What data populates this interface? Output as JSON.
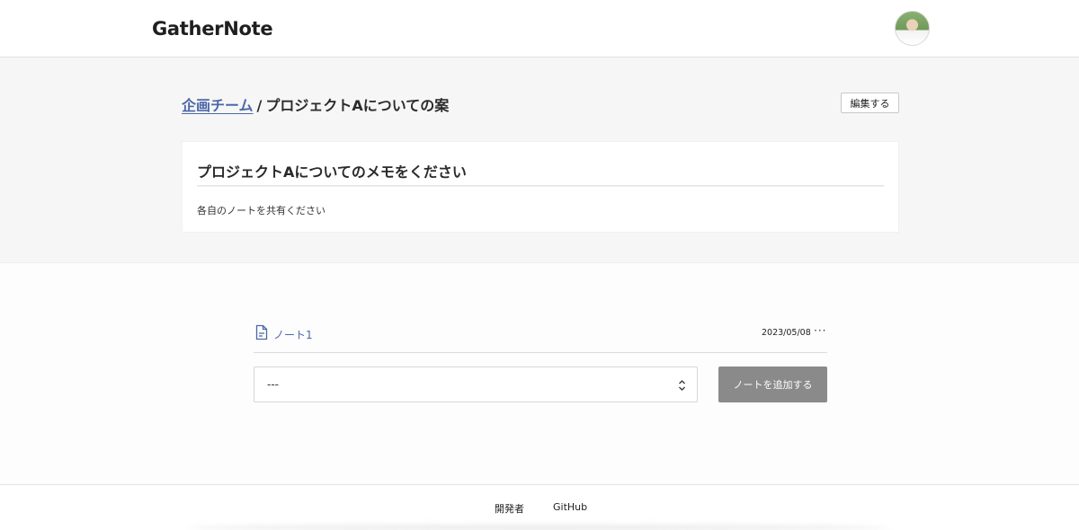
{
  "header": {
    "logo": "GatherNote",
    "avatar_icon": "user-avatar"
  },
  "breadcrumb": {
    "team": "企画チーム",
    "separator": "/",
    "current": "プロジェクトAについての案"
  },
  "edit_button": "編集する",
  "card": {
    "title": "プロジェクトAについてのメモをください",
    "body": "各自のノートを共有ください"
  },
  "notes": [
    {
      "icon": "document-icon",
      "name": "ノート1",
      "date": "2023/05/08",
      "menu": "···"
    }
  ],
  "note_select": {
    "value": "---",
    "arrow_icon": "select-updown-icon"
  },
  "add_note_button": "ノートを追加する",
  "footer": {
    "links": [
      "開発者",
      "GitHub"
    ]
  },
  "colors": {
    "accent": "#4b68a8",
    "band": "#f6f6f6",
    "button_gray": "#8a8a8a"
  }
}
